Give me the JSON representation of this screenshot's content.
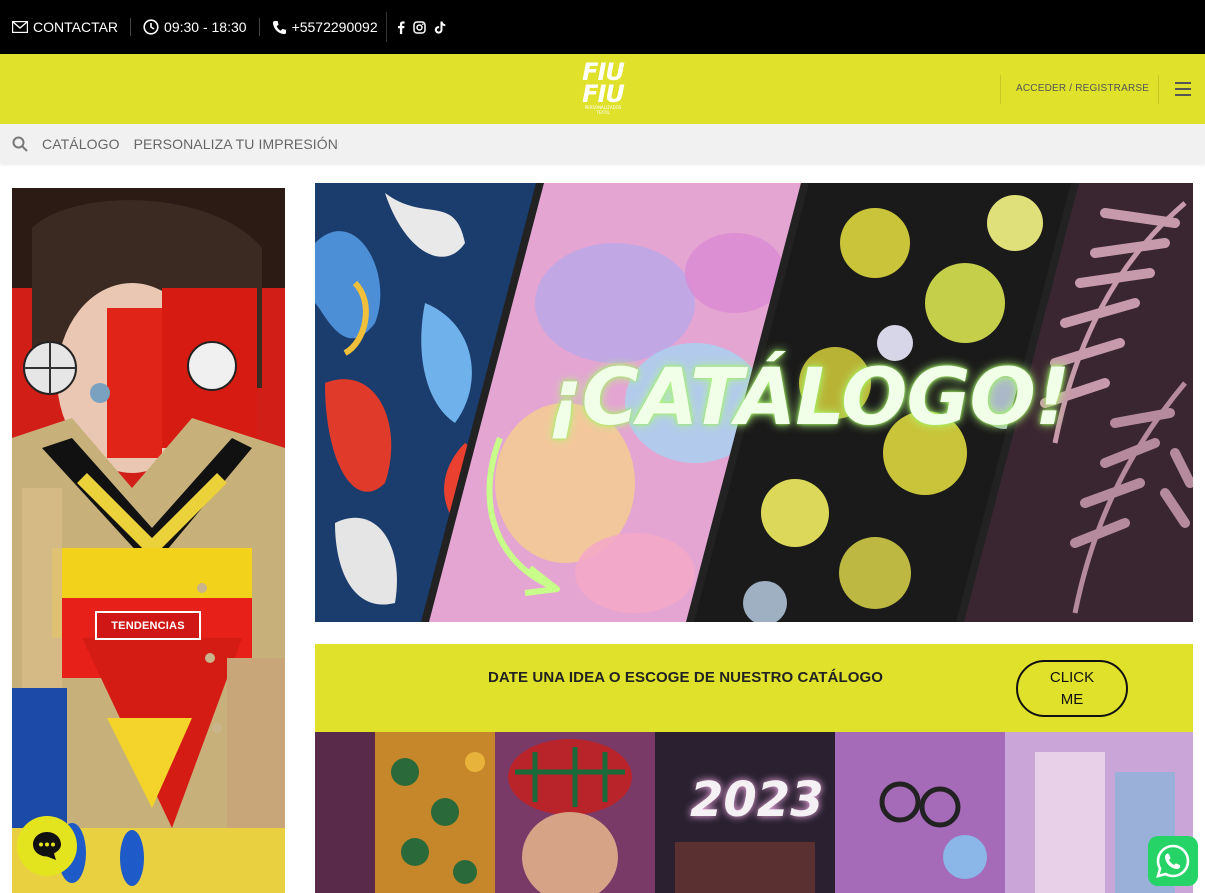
{
  "topbar": {
    "contact_label": "CONTACTAR",
    "hours": "09:30 - 18:30",
    "phone": "+5572290092",
    "social_icons": [
      "facebook-icon",
      "instagram-icon",
      "tiktok-icon"
    ]
  },
  "header": {
    "logo_line1": "FIU",
    "logo_line2": "FIU",
    "logo_tagline": "PERSONALIZADOS TEXTIL",
    "account_label": "ACCEDER / REGISTRARSE",
    "brand_color": "#dfe12a"
  },
  "nav": {
    "items": [
      {
        "label": "CATÁLOGO"
      },
      {
        "label": "PERSONALIZA TU IMPRESIÓN"
      }
    ]
  },
  "left_banner": {
    "tag_label": "TENDENCIAS"
  },
  "hero": {
    "title": "¡CATÁLOGO!"
  },
  "cta": {
    "text": "DATE UNA IDEA O ESCOGE DE NUESTRO CATÁLOGO",
    "button_line1": "CLICK",
    "button_line2": "ME"
  },
  "banner2023": {
    "year": "2023"
  }
}
